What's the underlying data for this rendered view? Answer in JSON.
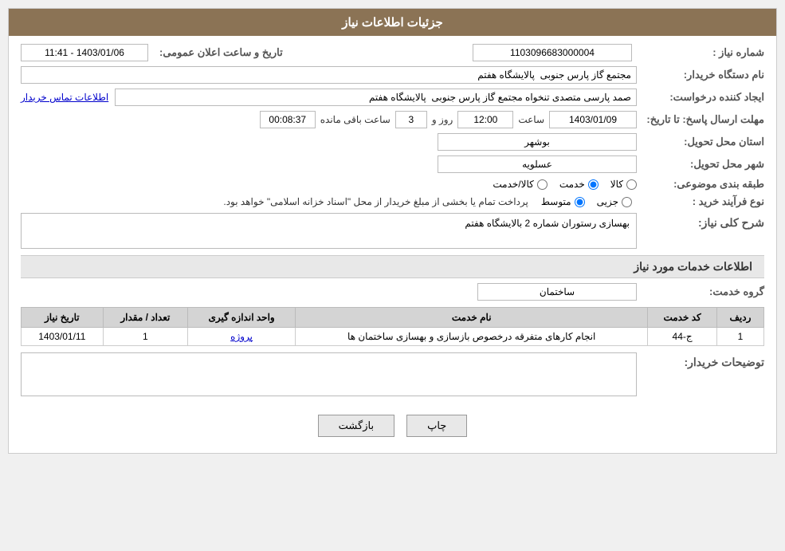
{
  "header": {
    "title": "جزئیات اطلاعات نیاز"
  },
  "fields": {
    "need_number_label": "شماره نیاز :",
    "need_number_value": "1103096683000004",
    "buyer_name_label": "نام دستگاه خریدار:",
    "buyer_name_value": "مجتمع گاز پارس جنوبی  پالایشگاه هفتم",
    "creator_label": "ایجاد کننده درخواست:",
    "creator_value": "صمد پارسی متصدی تنخواه مجتمع گاز پارس جنوبی  پالایشگاه هفتم",
    "creator_link": "اطلاعات تماس خریدار",
    "deadline_label": "مهلت ارسال پاسخ: تا تاریخ:",
    "deadline_date": "1403/01/09",
    "deadline_time_label": "ساعت",
    "deadline_time": "12:00",
    "deadline_day_label": "روز و",
    "deadline_days": "3",
    "deadline_remaining_label": "ساعت باقی مانده",
    "deadline_remaining": "00:08:37",
    "province_label": "استان محل تحویل:",
    "province_value": "بوشهر",
    "city_label": "شهر محل تحویل:",
    "city_value": "عسلویه",
    "category_label": "طبقه بندی موضوعی:",
    "category_options": [
      {
        "id": "kala",
        "label": "کالا"
      },
      {
        "id": "khadamat",
        "label": "خدمت"
      },
      {
        "id": "kala_khadamat",
        "label": "کالا/خدمت"
      }
    ],
    "category_selected": "khadamat",
    "process_label": "نوع فرآیند خرید :",
    "process_options": [
      {
        "id": "jozvi",
        "label": "جزیی"
      },
      {
        "id": "motovaset",
        "label": "متوسط"
      }
    ],
    "process_selected": "motovaset",
    "process_note": "پرداخت تمام یا بخشی از مبلغ خریدار از محل \"اسناد خزانه اسلامی\" خواهد بود.",
    "description_label": "شرح کلی نیاز:",
    "description_value": "بهسازی رستوران شماره 2 بالایشگاه هفتم",
    "services_section": "اطلاعات خدمات مورد نیاز",
    "service_group_label": "گروه خدمت:",
    "service_group_value": "ساختمان",
    "announce_label": "تاریخ و ساعت اعلان عمومی:",
    "announce_value": "1403/01/06 - 11:41"
  },
  "table": {
    "columns": [
      "ردیف",
      "کد خدمت",
      "نام خدمت",
      "واحد اندازه گیری",
      "تعداد / مقدار",
      "تاریخ نیاز"
    ],
    "rows": [
      {
        "row_num": "1",
        "code": "ج-44",
        "name": "انجام کارهای متفرقه درخصوص بازسازی و بهسازی ساختمان ها",
        "unit": "پروژه",
        "qty": "1",
        "date": "1403/01/11"
      }
    ]
  },
  "buyer_notes_label": "توضیحات خریدار:",
  "buyer_notes_value": "",
  "buttons": {
    "print": "چاپ",
    "back": "بازگشت"
  }
}
